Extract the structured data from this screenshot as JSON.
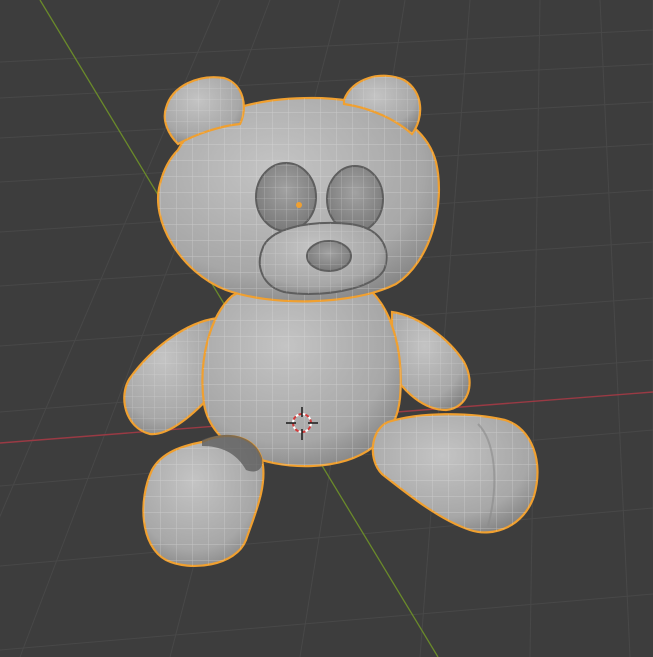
{
  "viewport": {
    "background_color": "#3d3d3d",
    "grid_line_color": "#484848",
    "x_axis_color": "#9a3a44",
    "y_axis_color": "#6a8a2a",
    "object_fill_color": "#b6b6b6",
    "wireframe_color": "#e6e6e6",
    "selection_outline_color": "#f0a030",
    "cursor_color": "#ffffff",
    "cursor_accent_color": "#d23a3a"
  },
  "scene_object": {
    "kind": "teddy-bear-mesh",
    "selected": true,
    "parts": [
      "head",
      "left-ear",
      "right-ear",
      "left-eye",
      "right-eye",
      "muzzle",
      "nose",
      "body",
      "left-arm",
      "right-arm",
      "left-leg",
      "right-leg"
    ]
  },
  "gizmos": {
    "cursor_icon": "3d-cursor-icon",
    "origin_icon": "object-origin-dot-icon"
  }
}
